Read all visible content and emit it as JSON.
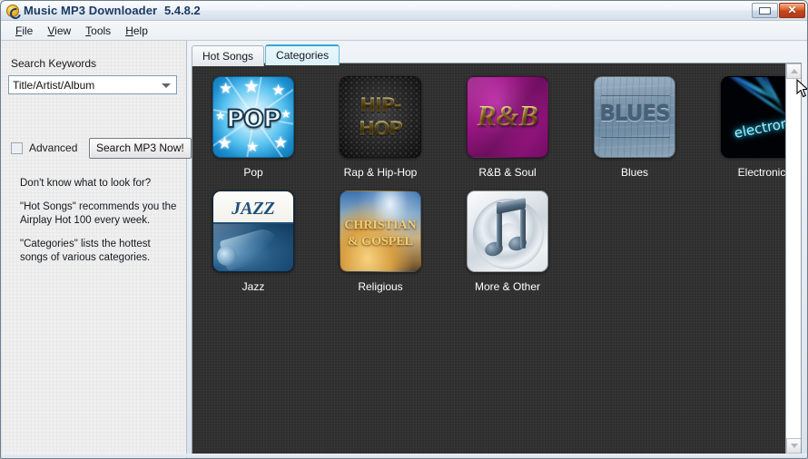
{
  "window": {
    "title": "Music MP3 Downloader",
    "version": "5.4.8.2",
    "app_icon": "music-disc-icon",
    "minimize_label": "",
    "close_label": "✕"
  },
  "menubar": {
    "items": [
      {
        "label": "File",
        "accel": "F"
      },
      {
        "label": "View",
        "accel": "V"
      },
      {
        "label": "Tools",
        "accel": "T"
      },
      {
        "label": "Help",
        "accel": "H"
      }
    ]
  },
  "sidebar": {
    "search_label": "Search Keywords",
    "search_field": {
      "value": "Title/Artist/Album",
      "placeholder": "Title/Artist/Album",
      "dropdown_icon": "chevron-down-icon"
    },
    "advanced_checkbox": {
      "label": "Advanced",
      "checked": false
    },
    "search_button": "Search MP3 Now!",
    "help": {
      "line1": "Don't know what to look for?",
      "line2": "\"Hot Songs\" recommends you the Airplay Hot 100 every week.",
      "line3": "\"Categories\" lists the hottest songs of various categories."
    }
  },
  "tabs": [
    {
      "label": "Hot Songs",
      "active": false
    },
    {
      "label": "Categories",
      "active": true
    }
  ],
  "categories": {
    "row1": [
      {
        "label": "Pop",
        "art_text": "POP",
        "accent": "#35a8e0"
      },
      {
        "label": "Rap & Hip-Hop",
        "art_line1": "HIP-",
        "art_line2": "HOP",
        "accent": "#e8c457"
      },
      {
        "label": "R&B & Soul",
        "art_text": "R&B",
        "accent": "#9c1786"
      },
      {
        "label": "Blues",
        "art_text": "BLUES",
        "accent": "#7e98ae"
      },
      {
        "label": "Electronic",
        "art_text": "electronic",
        "accent": "#3ad9ff"
      }
    ],
    "row2": [
      {
        "label": "Jazz",
        "art_text": "JAZZ",
        "accent": "#1f4f7a"
      },
      {
        "label": "Religious",
        "art_line1": "CHRISTIAN",
        "art_line2": "& GOSPEL",
        "accent": "#f0cd72"
      },
      {
        "label": "More & Other",
        "art_text": "music-note-disc-icon",
        "accent": "#566d81"
      }
    ]
  },
  "scrollbar": {
    "up_icon": "chevron-up-icon",
    "down_icon": "chevron-down-icon",
    "thumb_visible": false
  },
  "colors": {
    "panel_background": "#2e2e2e",
    "sidebar_background": "#f0f0f0",
    "title_text": "#1b3a63",
    "active_tab_border": "#3aa4d0",
    "label_text": "#ffffff"
  }
}
